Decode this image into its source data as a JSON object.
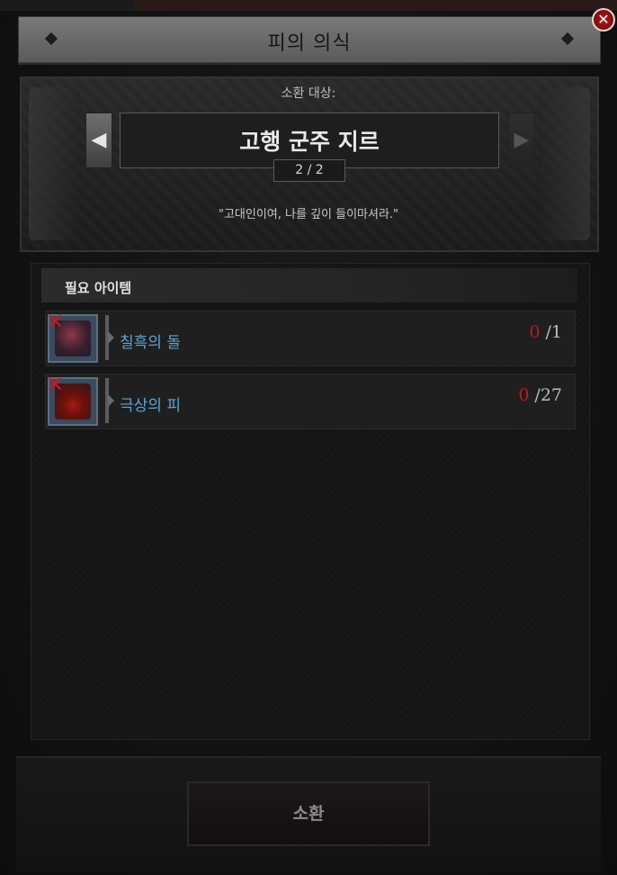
{
  "window": {
    "title": "피의 의식",
    "close_icon": "close-icon"
  },
  "summon": {
    "label": "소환 대상:",
    "boss_name": "고행 군주 지르",
    "page": "2 / 2",
    "quote": "\"고대인이여, 나를 깊이 들이마셔라.\"",
    "prev_icon": "triangle-left-icon",
    "next_icon": "triangle-right-icon"
  },
  "required": {
    "header": "필요 아이템",
    "items": [
      {
        "name": "칠흑의 돌",
        "have": "0",
        "need": "/1",
        "icon": "stone-icon"
      },
      {
        "name": "극상의 피",
        "have": "0",
        "need": "/27",
        "icon": "blood-vial-icon"
      }
    ]
  },
  "footer": {
    "summon_button": "소환"
  },
  "colors": {
    "item_name": "#5aa6d6",
    "missing_count": "#c0191e",
    "close_button": "#b21818"
  }
}
